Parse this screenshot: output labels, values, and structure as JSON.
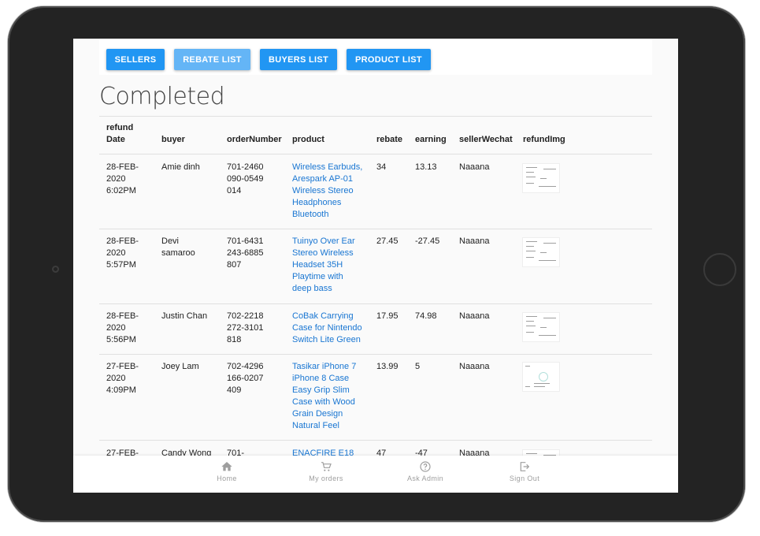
{
  "nav_buttons": {
    "sellers": "SELLERS",
    "rebate_list": "REBATE LIST",
    "buyers_list": "BUYERS LIST",
    "product_list": "PRODUCT LIST"
  },
  "page_title": "Completed",
  "table": {
    "headers": {
      "refund_date": "refund Date",
      "buyer": "buyer",
      "order_number": "orderNumber",
      "product": "product",
      "rebate": "rebate",
      "earning": "earning",
      "seller_wechat": "sellerWechat",
      "refund_img": "refundImg"
    },
    "rows": [
      {
        "date": "28-FEB-2020 6:02PM",
        "buyer": "Amie dinh",
        "order": "701-2460090-0549014",
        "product": "Wireless Earbuds, Arespark AP-01 Wireless Stereo Headphones Bluetooth",
        "rebate": "34",
        "earning": "13.13",
        "wechat": "Naaana"
      },
      {
        "date": "28-FEB-2020 5:57PM",
        "buyer": "Devi samaroo",
        "order": "701-6431243-6885807",
        "product": "Tuinyo Over Ear Stereo Wireless Headset 35H Playtime with deep bass",
        "rebate": "27.45",
        "earning": "-27.45",
        "wechat": "Naaana"
      },
      {
        "date": "28-FEB-2020 5:56PM",
        "buyer": "Justin Chan",
        "order": "702-2218272-3101818",
        "product": "CoBak Carrying Case for Nintendo Switch Lite Green",
        "rebate": "17.95",
        "earning": "74.98",
        "wechat": "Naaana"
      },
      {
        "date": "27-FEB-2020 4:09PM",
        "buyer": "Joey Lam",
        "order": "702-4296166-0207409",
        "product": "Tasikar iPhone 7 iPhone 8 Case Easy Grip Slim Case with Wood Grain Design Natural Feel",
        "rebate": "13.99",
        "earning": "5",
        "wechat": "Naaana"
      },
      {
        "date": "27-FEB-",
        "buyer": "Candy Wong",
        "order": "701-",
        "product": "ENACFIRE E18",
        "rebate": "47",
        "earning": "-47",
        "wechat": "Naaana"
      }
    ]
  },
  "bottom_nav": {
    "home": "Home",
    "orders": "My orders",
    "ask_admin": "Ask Admin",
    "sign_out": "Sign Out"
  }
}
